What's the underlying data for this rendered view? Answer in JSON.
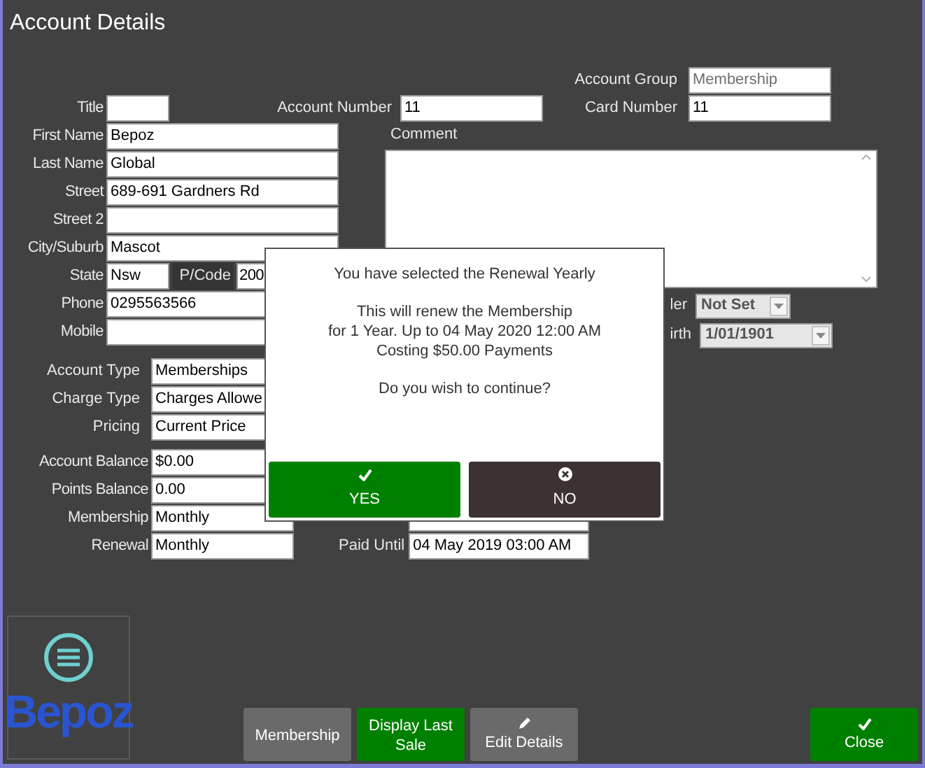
{
  "window": {
    "title": "Account Details"
  },
  "account_group": {
    "label": "Account Group",
    "value": "Membership",
    "disabled": true
  },
  "card_number": {
    "label": "Card Number",
    "value": "11"
  },
  "account_number": {
    "label": "Account Number",
    "value": "11"
  },
  "personal_fields": [
    {
      "label": "Title",
      "kind": "short"
    },
    {
      "label": "First Name",
      "value": "Bepoz",
      "kind": "text"
    },
    {
      "label": "Last Name",
      "value": "Global",
      "kind": "text"
    },
    {
      "label": "Street",
      "value": "689-691 Gardners Rd",
      "kind": "text"
    },
    {
      "label": "Street 2",
      "kind": "text"
    },
    {
      "label": "City/Suburb",
      "value": "Mascot",
      "kind": "text"
    },
    {
      "label": "State",
      "value": "Nsw",
      "kind": "short",
      "postcode": {
        "label": "P/Code",
        "value": "200"
      }
    },
    {
      "label": "Phone",
      "value": "0295563566",
      "kind": "text"
    },
    {
      "label": "Mobile",
      "kind": "text"
    }
  ],
  "comment": {
    "label": "Comment"
  },
  "gender": {
    "label": "ler",
    "value": "Not Set"
  },
  "birth": {
    "label": "irth",
    "value": "1/01/1901"
  },
  "account_fields": [
    {
      "label": "Account Type",
      "value": "Memberships"
    },
    {
      "label": "Charge Type",
      "value": "Charges Allowe"
    },
    {
      "label": "Pricing",
      "value": "Current Price"
    }
  ],
  "balance_fields": [
    {
      "label": "Account Balance",
      "value": "$0.00"
    },
    {
      "label": "Points Balance",
      "value": "0.00"
    },
    {
      "label": "Membership",
      "value": "Monthly"
    },
    {
      "label": "Renewal",
      "value": "Monthly"
    }
  ],
  "paid_until": {
    "label": "Paid Until",
    "value": "04 May 2019 03:00 AM"
  },
  "dialog": {
    "paragraphs": [
      "You have selected the Renewal Yearly",
      "This will renew the Membership\nfor 1 Year. Up to 04 May 2020 12:00 AM\nCosting $50.00 Payments",
      "Do you wish to continue?"
    ],
    "buttons": [
      {
        "label": "YES",
        "kind": "confirm"
      },
      {
        "label": "NO",
        "kind": "cancel"
      }
    ]
  },
  "logo": {
    "text": "Bepoz"
  },
  "footer_buttons": [
    {
      "label": "Membership",
      "kind": "plain"
    },
    {
      "label": "Display Last Sale",
      "kind": "highlight"
    },
    {
      "label": "Edit Details",
      "kind": "edit"
    },
    {
      "label": "Close",
      "kind": "close"
    }
  ]
}
